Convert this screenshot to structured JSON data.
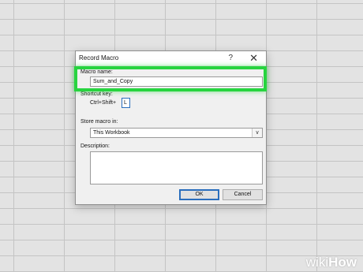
{
  "dialog": {
    "title": "Record Macro",
    "help_label": "?",
    "close_label": "✕",
    "macro_name_label": "Macro name:",
    "macro_name_value": "Sum_and_Copy",
    "shortcut_label": "Shortcut key:",
    "shortcut_prefix": "Ctrl+Shift+",
    "shortcut_value": "L",
    "store_label": "Store macro in:",
    "store_value": "This Workbook",
    "store_arrow": "∨",
    "description_label": "Description:",
    "ok_label": "OK",
    "cancel_label": "Cancel"
  },
  "watermark": {
    "prefix": "wiki",
    "suffix": "How"
  },
  "colors": {
    "highlight": "#27d43f",
    "focus_border": "#2a6ebd",
    "dialog_bg": "#f0f0f0"
  }
}
